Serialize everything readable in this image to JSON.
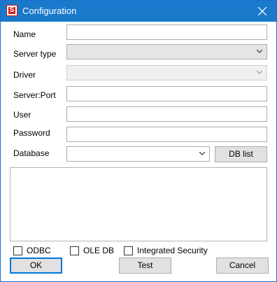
{
  "window": {
    "title": "Configuration",
    "app_icon_letter": "S"
  },
  "form": {
    "name_label": "Name",
    "name_value": "",
    "server_type_label": "Server type",
    "server_type_value": "",
    "driver_label": "Driver",
    "driver_value": "",
    "server_port_label": "Server:Port",
    "server_port_value": "",
    "user_label": "User",
    "user_value": "",
    "password_label": "Password",
    "password_value": "",
    "database_label": "Database",
    "database_value": "",
    "db_list_label": "DB list"
  },
  "options": {
    "odbc_label": "ODBC",
    "oledb_label": "OLE DB",
    "integrated_label": "Integrated Security",
    "odbc_checked": false,
    "oledb_checked": false,
    "integrated_checked": false
  },
  "buttons": {
    "ok": "OK",
    "test": "Test",
    "cancel": "Cancel"
  },
  "colors": {
    "titlebar": "#1979ca",
    "default_button_border": "#0078d7"
  },
  "icons": {
    "close": "close-icon",
    "chevron": "chevron-down-icon",
    "app": "app-icon"
  }
}
